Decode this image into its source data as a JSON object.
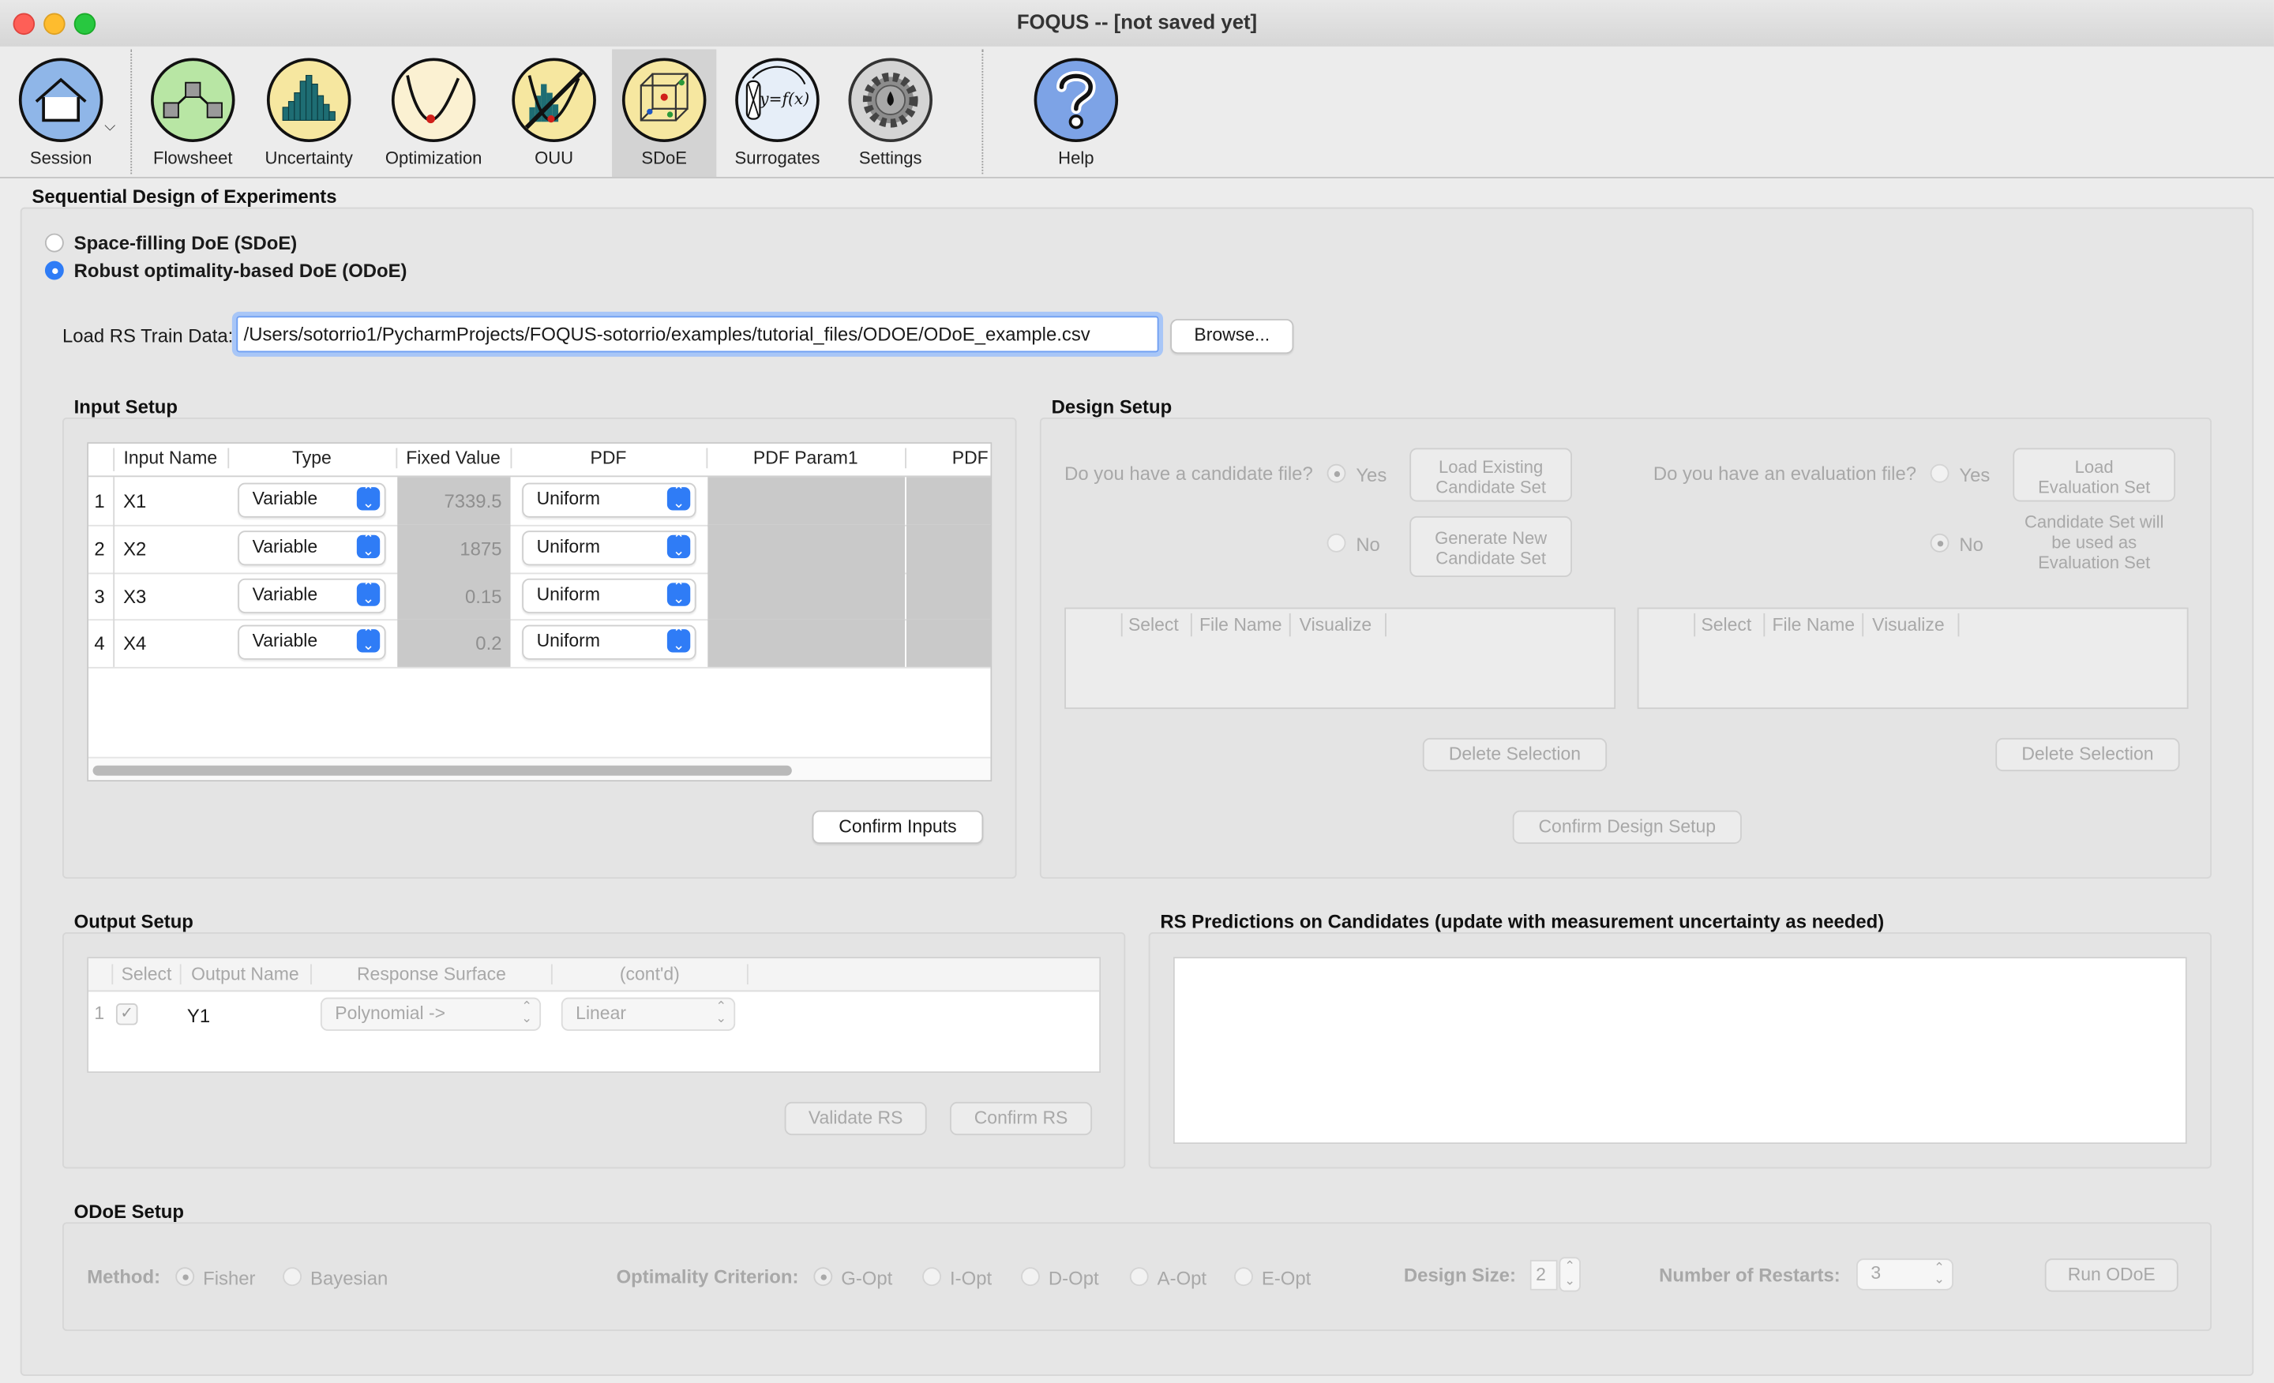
{
  "window": {
    "title": "FOQUS -- [not saved yet]"
  },
  "toolbar": {
    "items": [
      {
        "label": "Session",
        "icon": "house-icon"
      },
      {
        "label": "Flowsheet",
        "icon": "flowsheet-icon"
      },
      {
        "label": "Uncertainty",
        "icon": "histogram-icon"
      },
      {
        "label": "Optimization",
        "icon": "optimization-curve-icon"
      },
      {
        "label": "OUU",
        "icon": "ouu-icon"
      },
      {
        "label": "SDoE",
        "icon": "sdoe-cube-icon"
      },
      {
        "label": "Surrogates",
        "icon": "surrogate-function-icon"
      },
      {
        "label": "Settings",
        "icon": "gear-icon"
      },
      {
        "label": "Help",
        "icon": "help-question-icon"
      }
    ],
    "active": "SDoE"
  },
  "page": {
    "title": "Sequential Design of Experiments"
  },
  "mode": {
    "options": [
      "Space-filling DoE (SDoE)",
      "Robust optimality-based DoE (ODoE)"
    ],
    "selected": "Robust optimality-based DoE (ODoE)"
  },
  "load": {
    "label": "Load RS Train Data:",
    "path": "/Users/sotorrio1/PycharmProjects/FOQUS-sotorrio/examples/tutorial_files/ODOE/ODoE_example.csv",
    "browse": "Browse..."
  },
  "input_setup": {
    "title": "Input Setup",
    "columns": [
      "Input Name",
      "Type",
      "Fixed Value",
      "PDF",
      "PDF Param1",
      "PDF"
    ],
    "rows": [
      {
        "num": "1",
        "name": "X1",
        "type": "Variable",
        "fixed": "7339.5",
        "pdf": "Uniform"
      },
      {
        "num": "2",
        "name": "X2",
        "type": "Variable",
        "fixed": "1875",
        "pdf": "Uniform"
      },
      {
        "num": "3",
        "name": "X3",
        "type": "Variable",
        "fixed": "0.15",
        "pdf": "Uniform"
      },
      {
        "num": "4",
        "name": "X4",
        "type": "Variable",
        "fixed": "0.2",
        "pdf": "Uniform"
      }
    ],
    "confirm": "Confirm Inputs"
  },
  "design_setup": {
    "title": "Design Setup",
    "candidate_q": "Do you have a candidate file?",
    "eval_q": "Do you have an evaluation file?",
    "yes": "Yes",
    "no": "No",
    "load_candidate": [
      "Load Existing",
      "Candidate Set"
    ],
    "gen_candidate": [
      "Generate New",
      "Candidate Set"
    ],
    "load_eval": [
      "Load",
      "Evaluation Set"
    ],
    "eval_note": [
      "Candidate Set will",
      "be used as",
      "Evaluation Set"
    ],
    "file_columns": [
      "Select",
      "File Name",
      "Visualize"
    ],
    "delete": "Delete Selection",
    "confirm": "Confirm Design Setup"
  },
  "output_setup": {
    "title": "Output Setup",
    "columns": [
      "Select",
      "Output Name",
      "Response Surface",
      "(cont'd)"
    ],
    "rows": [
      {
        "num": "1",
        "name": "Y1",
        "rs": "Polynomial ->",
        "cont": "Linear",
        "checked": "✓"
      }
    ],
    "validate": "Validate RS",
    "confirm": "Confirm RS"
  },
  "rs_predictions": {
    "title": "RS Predictions on Candidates (update with measurement uncertainty as needed)"
  },
  "odoe_setup": {
    "title": "ODoE Setup",
    "method_label": "Method:",
    "methods": [
      "Fisher",
      "Bayesian"
    ],
    "method_selected": "Fisher",
    "criterion_label": "Optimality Criterion:",
    "criteria": [
      "G-Opt",
      "I-Opt",
      "D-Opt",
      "A-Opt",
      "E-Opt"
    ],
    "criterion_selected": "G-Opt",
    "design_size_label": "Design Size:",
    "design_size": "2",
    "restarts_label": "Number of Restarts:",
    "restarts": "3",
    "run": "Run ODoE"
  }
}
